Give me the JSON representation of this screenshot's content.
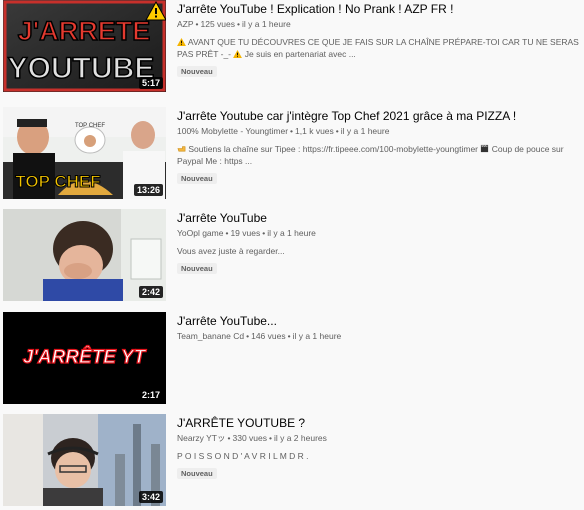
{
  "videos": [
    {
      "title": "J'arrête YouTube ! Explication ! No Prank ! AZP FR !",
      "channel": "AZP",
      "views": "125 vues",
      "time": "il y a 1 heure",
      "description": "AVANT QUE TU DÉCOUVRES CE QUE JE FAIS SUR LA CHAÎNE PRÉPARE-TOI CAR TU NE SERAS PAS PRÊT -_-",
      "description2": "Je suis en partenariat avec ...",
      "badge": "Nouveau",
      "duration": "5:17",
      "thumb_text_1": "J'ARRETE",
      "thumb_text_2": "YOUTUBE",
      "thumb_icons": [
        "warning-icon"
      ]
    },
    {
      "title": "J'arrête Youtube car j'intègre Top Chef 2021 grâce à ma PIZZA !",
      "channel": "100% Mobylette - Youngtimer",
      "views": "1,1 k vues",
      "time": "il y a 1 heure",
      "description": "Soutiens la chaîne sur Tipee : https://fr.tipeee.com/100-mobylette-youngtimer",
      "description_mid": "Coup de pouce sur Paypal Me : https ...",
      "badge": "Nouveau",
      "duration": "13:26",
      "thumb_text_1": "TOP CHEF",
      "thumb_icons": [
        "pointing-hand-icon",
        "clapperboard-icon"
      ]
    },
    {
      "title": "J'arrête YouTube",
      "channel": "YoOpl game",
      "views": "19 vues",
      "time": "il y a 1 heure",
      "description": "Vous avez juste à regarder...",
      "badge": "Nouveau",
      "duration": "2:42"
    },
    {
      "title": "J'arrête YouTube...",
      "channel": "Team_banane Cd",
      "views": "146 vues",
      "time": "il y a 1 heure",
      "duration": "2:17",
      "thumb_text_1": "J'ARRÊTE YT"
    },
    {
      "title": "J'ARRÊTE YOUTUBE ?",
      "channel": "Nearzy YTッ",
      "views": "330 vues",
      "time": "il y a 2 heures",
      "description": "P O I S S O N D ' A V R I L M D R .",
      "badge": "Nouveau",
      "duration": "3:42"
    }
  ],
  "colors": {
    "background": "#f9f9f9",
    "title": "#030303",
    "meta": "#606060",
    "badge_bg": "#eeeeee"
  }
}
